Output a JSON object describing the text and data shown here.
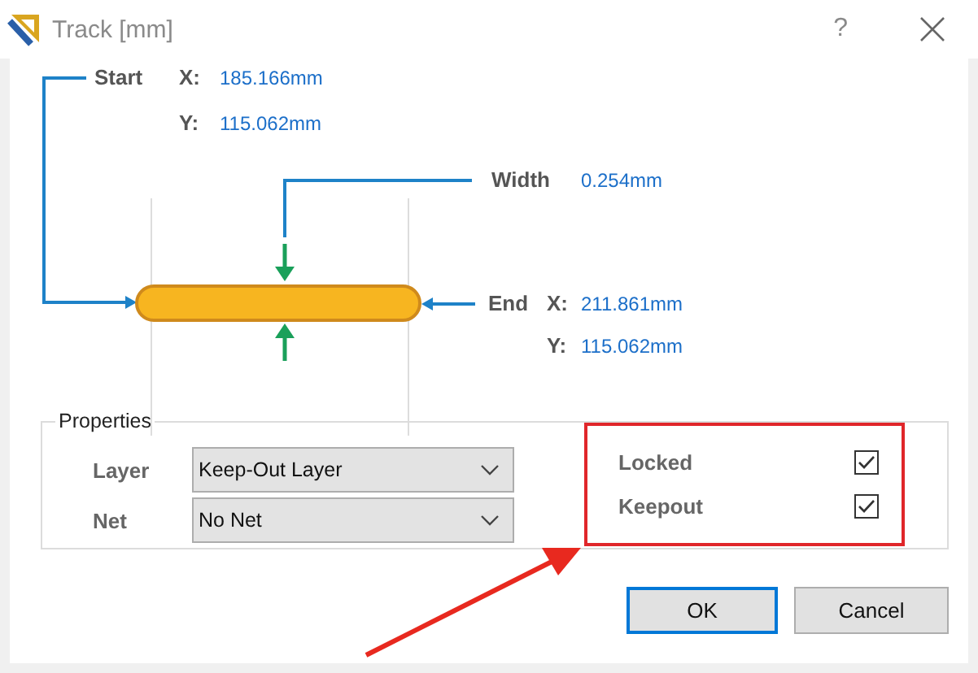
{
  "window": {
    "title": "Track [mm]",
    "help": "?"
  },
  "start": {
    "label": "Start",
    "x_label": "X:",
    "x": "185.166mm",
    "y_label": "Y:",
    "y": "115.062mm"
  },
  "width": {
    "label": "Width",
    "value": "0.254mm"
  },
  "end": {
    "label": "End",
    "x_label": "X:",
    "x": "211.861mm",
    "y_label": "Y:",
    "y": "115.062mm"
  },
  "properties": {
    "title": "Properties",
    "fields": [
      {
        "label": "Layer",
        "value": "Keep-Out Layer"
      },
      {
        "label": "Net",
        "value": "No Net"
      }
    ],
    "options": [
      {
        "label": "Locked",
        "checked": true
      },
      {
        "label": "Keepout",
        "checked": true
      }
    ]
  },
  "buttons": [
    {
      "label": "OK",
      "default": true
    },
    {
      "label": "Cancel",
      "default": false
    }
  ]
}
